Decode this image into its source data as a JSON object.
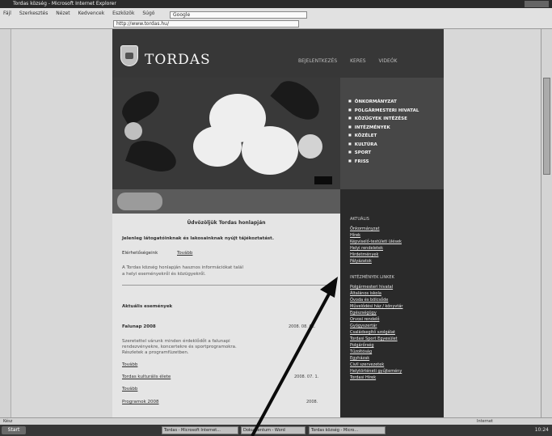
{
  "browser": {
    "title": "Tordas község - Microsoft Internet Explorer",
    "menu": [
      "Fájl",
      "Szerkesztés",
      "Nézet",
      "Kedvencek",
      "Eszközök",
      "Súgó"
    ],
    "search_label": "Google",
    "address": "http://www.tordas.hu/"
  },
  "site": {
    "brand": "TORDAS",
    "topnav": [
      "BEJELENTKEZÉS",
      "KERES",
      "VIDEÓK"
    ],
    "menu": [
      "ÖNKORMÁNYZAT",
      "POLGÁRMESTERI HIVATAL",
      "KÖZÜGYEK INTÉZÉSE",
      "INTÉZMÉNYEK",
      "KÖZÉLET",
      "KULTÚRA",
      "SPORT",
      "FRISS"
    ]
  },
  "content": {
    "heading": "Üdvözöljük Tordas honlapján",
    "intro": "Jelenleg látogatóinknak és lakosainknak nyújt tájékoztatást.",
    "contact_label": "Elérhetőségeink",
    "contact_link": "Tovább",
    "desc_1": "A Tordas község honlapján hasznos információkat talál",
    "desc_2": "a helyi eseményekről és közügyekről.",
    "news_heading": "Aktuális események",
    "item1_title": "Falunap 2008",
    "item1_date": "2008. 08. 02.",
    "item1_text_1": "Szeretettel várunk minden érdeklődőt a falunapi",
    "item1_text_2": "rendezvényekre, koncertekre és sportprogramokra.",
    "item1_text_3": "Részletek a programfüzetben.",
    "more_1": "Tovább",
    "item2_title": "Tordas kulturális élete",
    "item2_date": "2008. 07. 1.",
    "more_2": "Tovább",
    "item3_title": "Programok 2008",
    "item3_date": "2008."
  },
  "sidebar": {
    "heading_1": "AKTUÁLIS",
    "links_1": [
      "Önkormányzat",
      "Hírek",
      "Képviselő-testületi ülések",
      "Helyi rendeletek",
      "Hirdetmények",
      "Pályázatok"
    ],
    "heading_2": "INTÉZMÉNYEK LINKEK",
    "links_2": [
      "Polgármesteri hivatal",
      "Általános iskola",
      "Óvoda és bölcsőde",
      "Művelődési ház / könyvtár",
      "Egészségügy",
      "Orvosi rendelő",
      "Gyógyszertár",
      "Családsegítő szolgálat",
      "Tordasi Sport Egyesület",
      "Polgárőrség",
      "Tűzoltóság",
      "Egyházak",
      "Civil szervezetek",
      "Helytörténeti gyűjtemény",
      "Tordasi Hírek"
    ]
  },
  "statusbar": {
    "text": "Kész",
    "zone": "Internet"
  },
  "taskbar": {
    "start": "Start",
    "tasks": [
      "Tordas - Microsoft Internet...",
      "Dokumentum - Word",
      "Tordas község - Micro..."
    ],
    "clock": "10:24"
  }
}
